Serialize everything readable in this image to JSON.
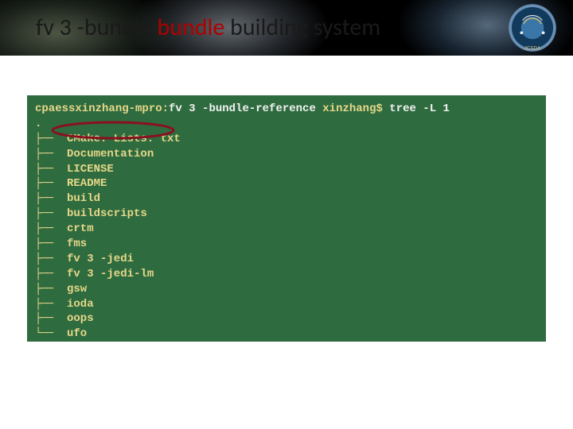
{
  "title": {
    "part1": "fv 3 -bundle ",
    "part2_red": "bundle",
    "part3": " building system"
  },
  "terminal": {
    "prompt_host": "cpaessxinzhang-mpro:",
    "prompt_dir": "fv 3 -bundle-reference",
    "prompt_user": " xinzhang$ ",
    "command": "tree -L 1",
    "root": ".",
    "entries": [
      "CMake. Lists. txt",
      "Documentation",
      "LICENSE",
      "README",
      "build",
      "buildscripts",
      "crtm",
      "fms",
      "fv 3 -jedi",
      "fv 3 -jedi-lm",
      "gsw",
      "ioda",
      "oops",
      "ufo"
    ]
  }
}
